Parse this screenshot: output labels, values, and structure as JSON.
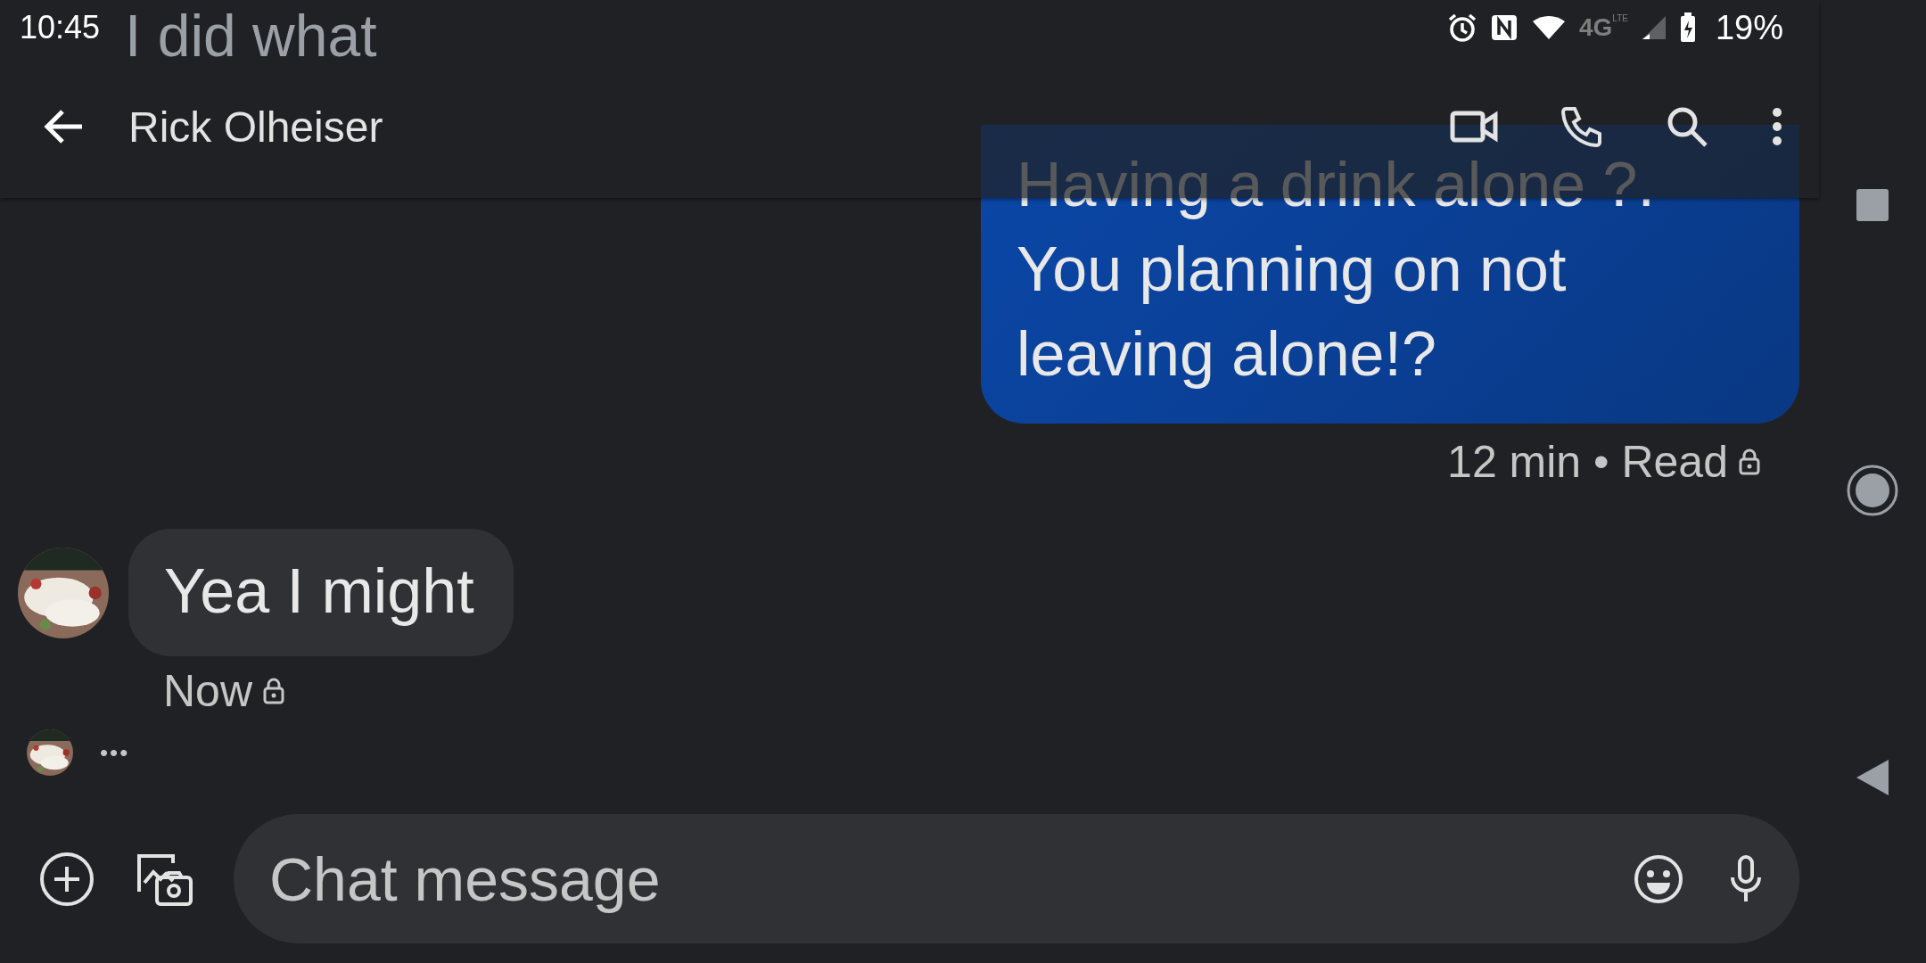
{
  "status_bar": {
    "time": "10:45",
    "network": "4G",
    "network_sub": "LTE",
    "battery": "19%"
  },
  "header": {
    "contact_name": "Rick Olheiser"
  },
  "messages": [
    {
      "kind": "incoming",
      "text": "I did what",
      "faded": true
    },
    {
      "kind": "outgoing",
      "lines": [
        "Having a drink alone ?.",
        "You planning on not",
        "leaving alone!?"
      ],
      "meta": "12 min • Read"
    },
    {
      "kind": "incoming",
      "text": "Yea I might",
      "meta": "Now",
      "faded": false
    },
    {
      "kind": "typing",
      "text": "•••"
    }
  ],
  "composer": {
    "placeholder": "Chat message"
  }
}
